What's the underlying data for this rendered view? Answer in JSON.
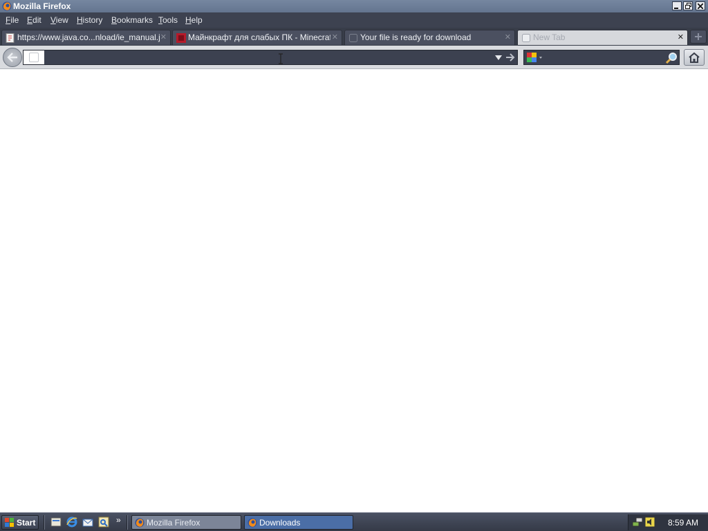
{
  "window": {
    "title": "Mozilla Firefox"
  },
  "menu": [
    {
      "label": "File",
      "access": "F",
      "rest": "ile"
    },
    {
      "label": "Edit",
      "access": "E",
      "rest": "dit"
    },
    {
      "label": "View",
      "access": "V",
      "rest": "iew"
    },
    {
      "label": "History",
      "access": "H",
      "rest": "istory"
    },
    {
      "label": "Bookmarks",
      "access": "B",
      "rest": "ookmarks"
    },
    {
      "label": "Tools",
      "access": "T",
      "rest": "ools"
    },
    {
      "label": "Help",
      "access": "H",
      "rest": "elp"
    }
  ],
  "tabs": [
    {
      "label": "https://www.java.co...nload/ie_manual.jsp",
      "icon": "java-page-icon"
    },
    {
      "label": "Майнкрафт для слабых ПК - Minecraft ...",
      "icon": "minecraft-site-icon"
    },
    {
      "label": "Your file is ready for download",
      "icon": "blank-page-icon"
    },
    {
      "label": "New Tab",
      "icon": "blank-page-icon",
      "active": true
    }
  ],
  "navbar": {
    "url_value": "",
    "search_value": "",
    "search_engine": "google-icon"
  },
  "taskbar": {
    "start_label": "Start",
    "tasks": [
      {
        "label": "Mozilla Firefox",
        "icon": "firefox-icon",
        "active": true
      },
      {
        "label": "Downloads",
        "icon": "firefox-icon",
        "active": false
      }
    ],
    "quicklaunch_more": "»",
    "clock": "8:59 AM"
  },
  "colors": {
    "chrome_dark": "#3d4250",
    "titlebar": "#6a7b94",
    "task_active": "#7c8598",
    "task_normal": "#4b6ea6"
  }
}
